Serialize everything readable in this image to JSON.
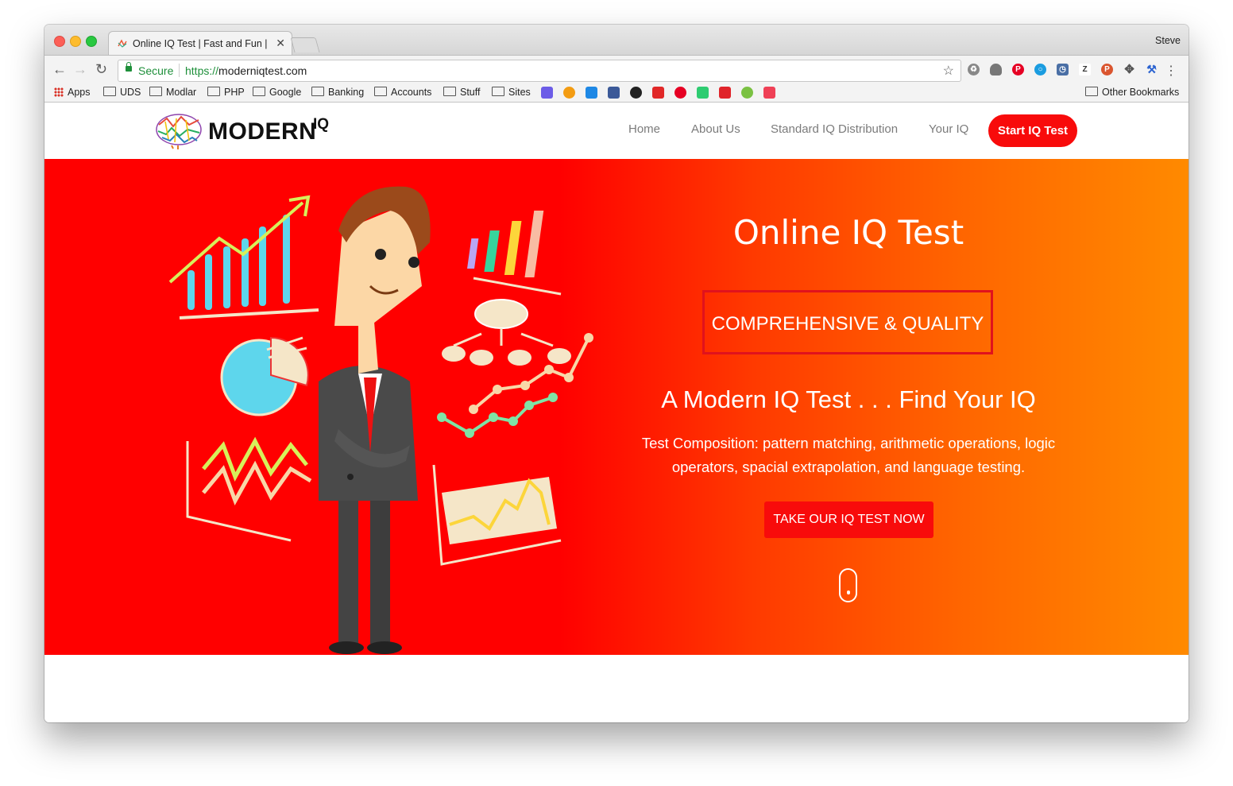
{
  "browser": {
    "tab_title": "Online IQ Test | Fast and Fun |",
    "tab_close": "✕",
    "profile": "Steve",
    "secure_label": "Secure",
    "url_scheme": "https://",
    "url_host": "moderniqtest.com",
    "bookmarks": [
      "Apps",
      "UDS",
      "Modlar",
      "PHP",
      "Google",
      "Banking",
      "Accounts",
      "Stuff",
      "Sites"
    ],
    "other_bookmarks": "Other Bookmarks",
    "extension_icons": [
      "recycle-icon",
      "cloud-icon",
      "pinterest-icon",
      "circle-icon",
      "clock-icon",
      "zotero-icon",
      "product-hunt-icon",
      "move-icon",
      "wrench-icon"
    ],
    "bookmark_icons": [
      "s-icon",
      "bitcoin-icon",
      "c-icon",
      "facebook-icon",
      "s2-icon",
      "flipboard-icon",
      "pinterest-icon",
      "p-icon",
      "inbox-icon",
      "evernote-icon",
      "pocket-icon"
    ]
  },
  "site": {
    "logo_text": "MODERN",
    "logo_sup": "IQ",
    "nav": [
      "Home",
      "About Us",
      "Standard IQ Distribution",
      "Your IQ"
    ],
    "nav_cta": "Start IQ Test",
    "hero": {
      "title": "Online IQ Test",
      "badge": "COMPREHENSIVE & QUALITY",
      "tagline": "A Modern IQ Test . . . Find Your IQ",
      "composition": "Test Composition: pattern matching, arithmetic operations, logic operators, spacial extrapolation, and language testing.",
      "cta": "TAKE OUR IQ TEST NOW"
    },
    "colors": {
      "accent": "#f80b0b",
      "hero_start": "#ff0000",
      "hero_end": "#ff8a00"
    }
  }
}
